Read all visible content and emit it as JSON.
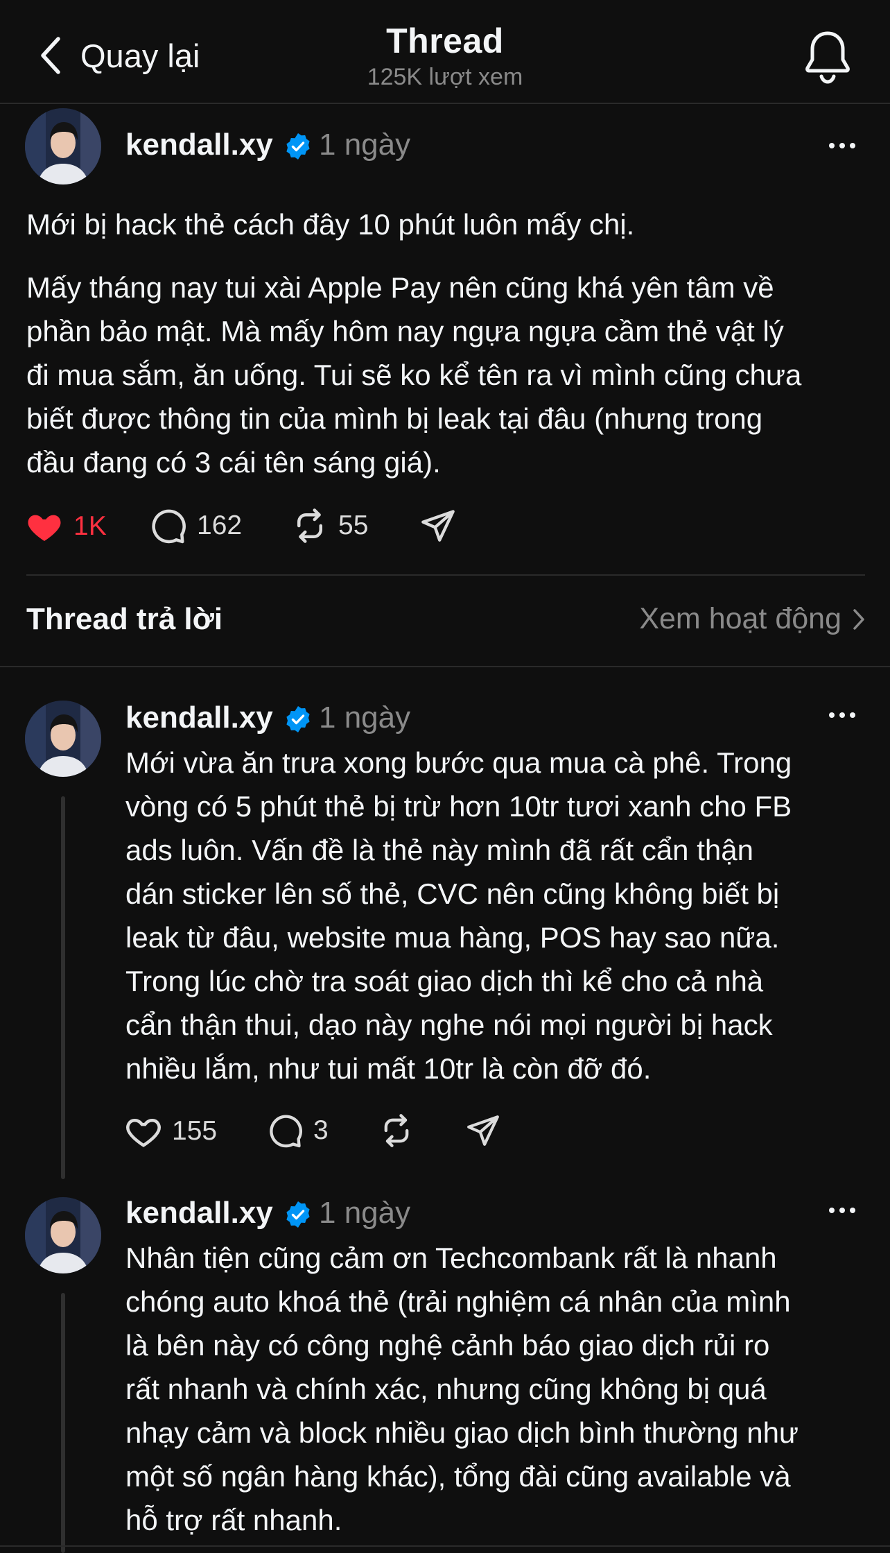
{
  "header": {
    "back_label": "Quay lại",
    "title": "Thread",
    "views": "125K lượt xem"
  },
  "post": {
    "username": "kendall.xy",
    "time": "1 ngày",
    "paragraph1": "Mới bị hack thẻ cách đây 10 phút luôn mấy chị.",
    "paragraph2_lines": [
      "Mấy tháng nay tui xài Apple Pay nên cũng khá yên tâm về",
      "phần bảo mật. Mà mấy hôm nay ngựa ngựa cầm thẻ vật lý",
      "đi mua sắm, ăn uống. Tui sẽ ko kể tên ra vì mình cũng chưa",
      "biết được thông tin của mình bị leak tại đâu (nhưng trong",
      "đầu đang có 3 cái tên sáng giá)."
    ],
    "likes": "1K",
    "replies": "162",
    "reposts": "55"
  },
  "replies_section": {
    "title": "Thread trả lời",
    "activity_link": "Xem hoạt động"
  },
  "replies": [
    {
      "username": "kendall.xy",
      "time": "1 ngày",
      "lines": [
        "Mới vừa ăn trưa xong bước qua mua cà phê. Trong",
        "vòng có 5 phút thẻ bị trừ hơn 10tr tươi xanh cho FB",
        "ads luôn. Vấn đề là thẻ này mình đã rất cẩn thận",
        "dán sticker lên số thẻ, CVC nên cũng không biết bị",
        "leak từ đâu, website mua hàng, POS hay sao nữa.",
        "Trong lúc chờ tra soát giao dịch thì kể cho cả nhà",
        "cẩn thận thui, dạo này nghe nói mọi người bị hack",
        "nhiều lắm, như tui mất 10tr là còn đỡ đó."
      ],
      "likes": "155",
      "replies": "3"
    },
    {
      "username": "kendall.xy",
      "time": "1 ngày",
      "lines": [
        "Nhân tiện cũng cảm ơn Techcombank rất là nhanh",
        "chóng auto khoá thẻ (trải nghiệm cá nhân của mình",
        "là bên này có công nghệ cảnh báo giao dịch rủi ro",
        "rất nhanh và chính xác, nhưng cũng không bị quá",
        "nhạy cảm và block nhiều giao dịch bình thường như",
        "một số ngân hàng khác), tổng đài cũng available và",
        "hỗ trợ rất nhanh."
      ]
    }
  ],
  "icons": {
    "back": "chevron-left-icon",
    "bell": "bell-icon",
    "verified": "verified-badge-icon",
    "more": "more-horizontal-icon",
    "like": "heart-icon",
    "reply": "comment-bubble-icon",
    "repost": "repost-icon",
    "share": "send-icon"
  },
  "colors": {
    "background": "#0f0f0f",
    "text": "#f3f5f7",
    "secondary": "#8a8a8a",
    "like_red": "#ff3040",
    "verified_blue": "#0095f6"
  }
}
